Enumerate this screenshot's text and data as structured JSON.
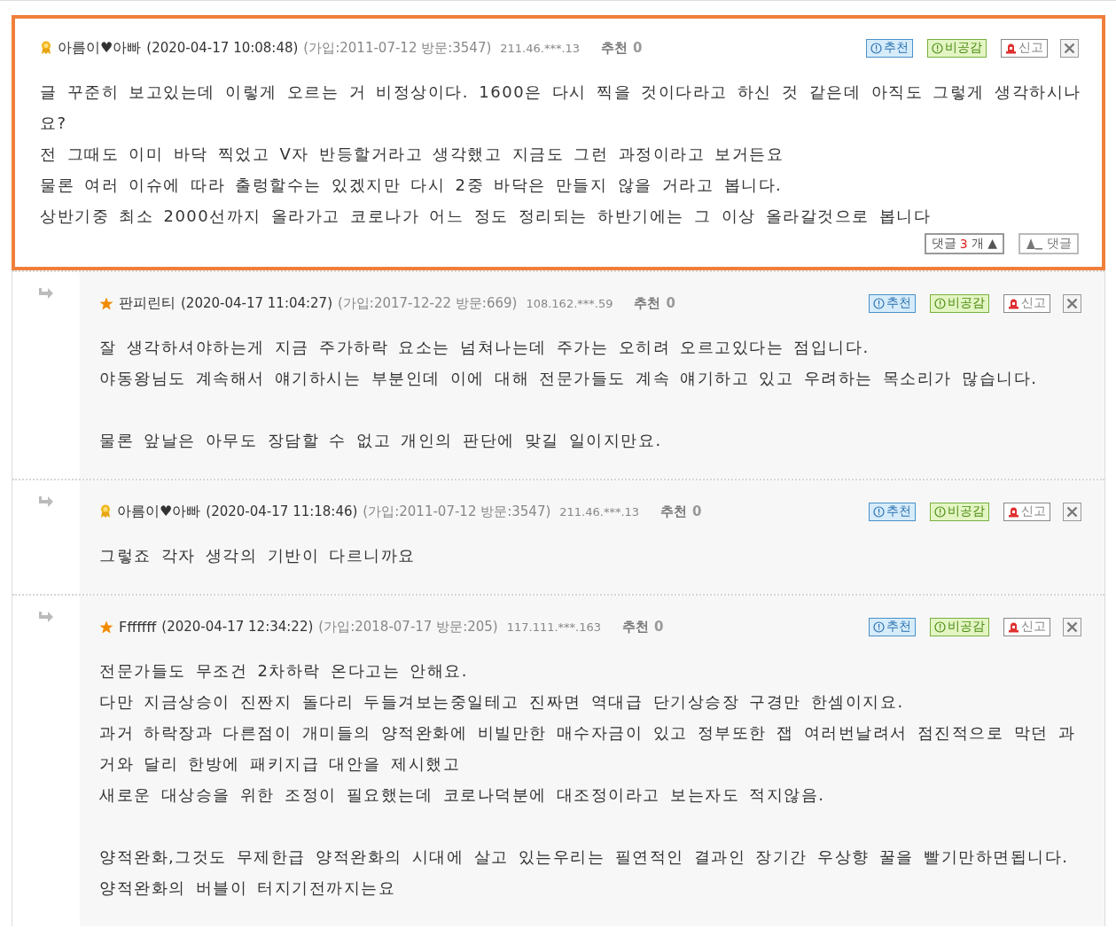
{
  "comments": [
    {
      "kind": "comment",
      "highlighted": true,
      "author": {
        "kind": "medal",
        "name": "아름이♥아빠"
      },
      "datetime": "(2020-04-17 10:08:48)",
      "member_info": "(가입:2011-07-12 방문:3547)",
      "ip": "211.46.***.13",
      "recommend_label": "추천",
      "recommend_count": "0",
      "actions": [
        "추천",
        "비공감",
        "신고"
      ],
      "paragraphs": [
        [
          "글 꾸준히 보고있는데 이렇게 오르는 거 비정상이다. 1600은 다시 찍을 것이다라고 하신 것 같은데 아직도 그렇게 생각하시나",
          "요?",
          "전 그때도 이미 바닥 찍었고 V자 반등할거라고 생각했고 지금도 그런 과정이라고 보거든요",
          "물론 여러 이슈에 따라 출렁할수는 있겠지만 다시 2중 바닥은 만들지 않을 거라고 봅니다.",
          "상반기중 최소 2000선까지 올라가고 코로나가 어느 정도 정리되는 하반기에는 그 이상 올라갈것으로 봅니다"
        ]
      ],
      "footer": {
        "replies_label": "댓글",
        "replies_count": "3",
        "replies_unit": "개",
        "toggle": "▲",
        "write_label": "댓글"
      }
    },
    {
      "kind": "reply",
      "highlighted": false,
      "author": {
        "kind": "star",
        "name": "판피린티"
      },
      "datetime": "(2020-04-17 11:04:27)",
      "member_info": "(가입:2017-12-22 방문:669)",
      "ip": "108.162.***.59",
      "recommend_label": "추천",
      "recommend_count": "0",
      "actions": [
        "추천",
        "비공감",
        "신고"
      ],
      "paragraphs": [
        [
          "잘 생각하셔야하는게 지금 주가하락 요소는 넘쳐나는데 주가는 오히려 오르고있다는 점입니다.",
          "야동왕님도 계속해서 얘기하시는 부분인데 이에 대해 전문가들도 계속 얘기하고 있고 우려하는 목소리가 많습니다."
        ],
        [
          "물론 앞날은 아무도 장담할 수 없고 개인의 판단에 맞길 일이지만요."
        ]
      ]
    },
    {
      "kind": "reply",
      "highlighted": false,
      "author": {
        "kind": "medal",
        "name": "아름이♥아빠"
      },
      "datetime": "(2020-04-17 11:18:46)",
      "member_info": "(가입:2011-07-12 방문:3547)",
      "ip": "211.46.***.13",
      "recommend_label": "추천",
      "recommend_count": "0",
      "actions": [
        "추천",
        "비공감",
        "신고"
      ],
      "paragraphs": [
        [
          "그렇죠 각자 생각의 기반이 다르니까요"
        ]
      ]
    },
    {
      "kind": "reply",
      "highlighted": false,
      "author": {
        "kind": "star",
        "name": "Fffffff"
      },
      "datetime": "(2020-04-17 12:34:22)",
      "member_info": "(가입:2018-07-17 방문:205)",
      "ip": "117.111.***.163",
      "recommend_label": "추천",
      "recommend_count": "0",
      "actions": [
        "추천",
        "비공감",
        "신고"
      ],
      "paragraphs": [
        [
          "전문가들도 무조건 2차하락 온다고는 안해요.",
          "다만 지금상승이 진짠지 돌다리 두들겨보는중일테고 진짜면 역대급 단기상승장 구경만 한셈이지요.",
          "과거 하락장과 다른점이 개미들의 양적완화에 비빌만한 매수자금이 있고 정부또한 잽 여러번날려서 점진적으로 막던 과",
          "거와 달리 한방에 패키지급 대안을 제시했고",
          "새로운 대상승을 위한 조정이 필요했는데 코로나덕분에 대조정이라고 보는자도 적지않음."
        ],
        [
          "양적완화,그것도 무제한급 양적완화의 시대에 살고 있는우리는 필연적인 결과인 장기간 우상향 꿀을 빨기만하면됩니다.",
          "양적완화의 버블이 터지기전까지는요"
        ]
      ]
    }
  ]
}
